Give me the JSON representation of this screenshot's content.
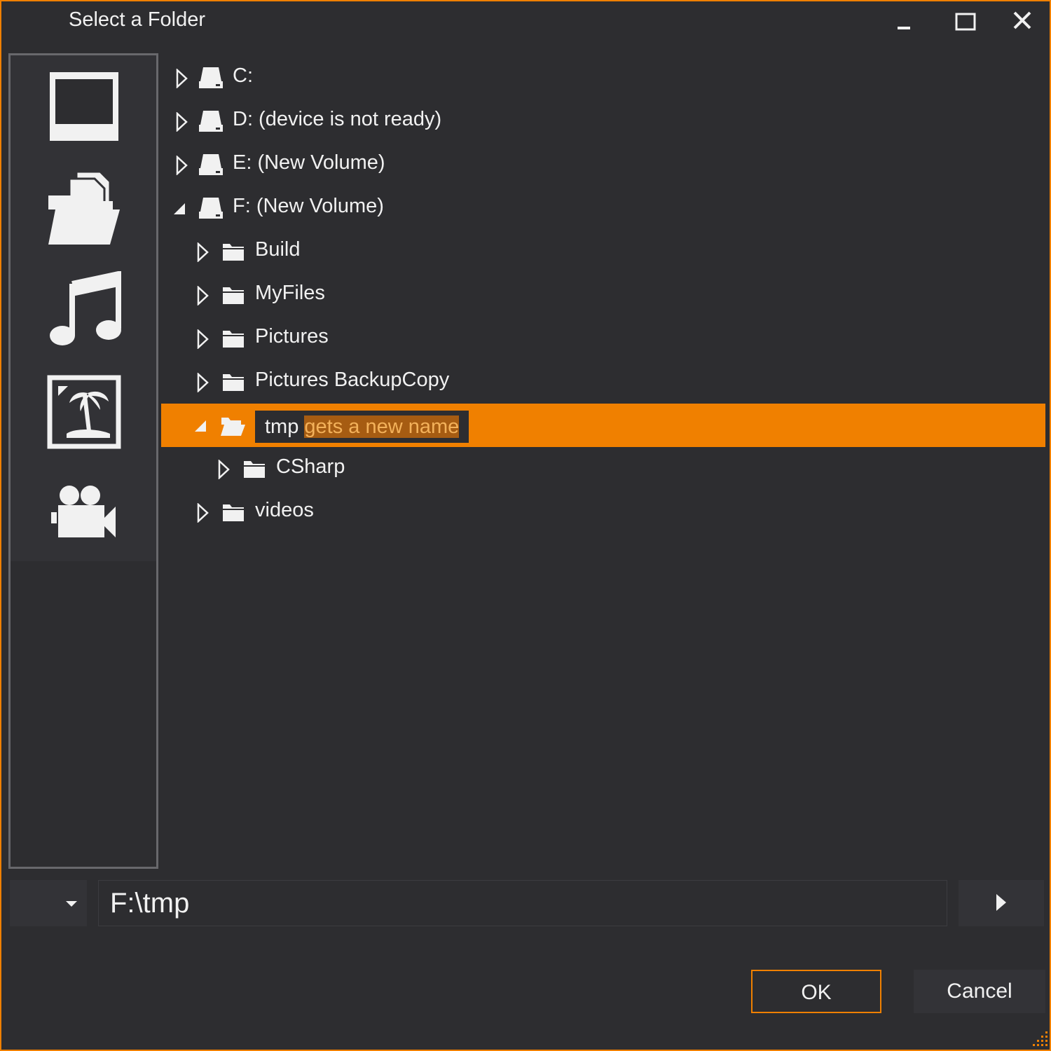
{
  "window": {
    "title": "Select a Folder",
    "accent_color": "#f08000",
    "controls": [
      "minimize-icon",
      "maximize-icon",
      "close-icon"
    ]
  },
  "sidebar": {
    "items": [
      {
        "icon": "computer-icon"
      },
      {
        "icon": "documents-folder-icon"
      },
      {
        "icon": "music-icon"
      },
      {
        "icon": "pictures-icon"
      },
      {
        "icon": "videos-icon"
      }
    ]
  },
  "tree": {
    "nodes": [
      {
        "label": "C:",
        "icon": "drive-icon",
        "expanded": false,
        "level": 0
      },
      {
        "label": "D: (device is not ready)",
        "icon": "drive-icon",
        "expanded": false,
        "level": 0
      },
      {
        "label": "E: (New Volume)",
        "icon": "drive-icon",
        "expanded": false,
        "level": 0
      },
      {
        "label": "F: (New Volume)",
        "icon": "drive-icon",
        "expanded": true,
        "level": 0
      },
      {
        "label": "Build",
        "icon": "folder-icon",
        "expanded": false,
        "level": 1
      },
      {
        "label": "MyFiles",
        "icon": "folder-icon",
        "expanded": false,
        "level": 1
      },
      {
        "label": "Pictures",
        "icon": "folder-icon",
        "expanded": false,
        "level": 1
      },
      {
        "label": "Pictures BackupCopy",
        "icon": "folder-icon",
        "expanded": false,
        "level": 1
      },
      {
        "label": "tmp",
        "icon": "folder-open-icon",
        "expanded": true,
        "level": 1,
        "selected": true,
        "editing": true
      },
      {
        "label": "CSharp",
        "icon": "folder-icon",
        "expanded": false,
        "level": 2
      },
      {
        "label": "videos",
        "icon": "folder-icon",
        "expanded": false,
        "level": 1
      }
    ],
    "edit": {
      "prefix": "tmp ",
      "selected_text": "gets a new name"
    }
  },
  "path_bar": {
    "value": "F:\\tmp"
  },
  "buttons": {
    "ok": "OK",
    "cancel": "Cancel"
  }
}
